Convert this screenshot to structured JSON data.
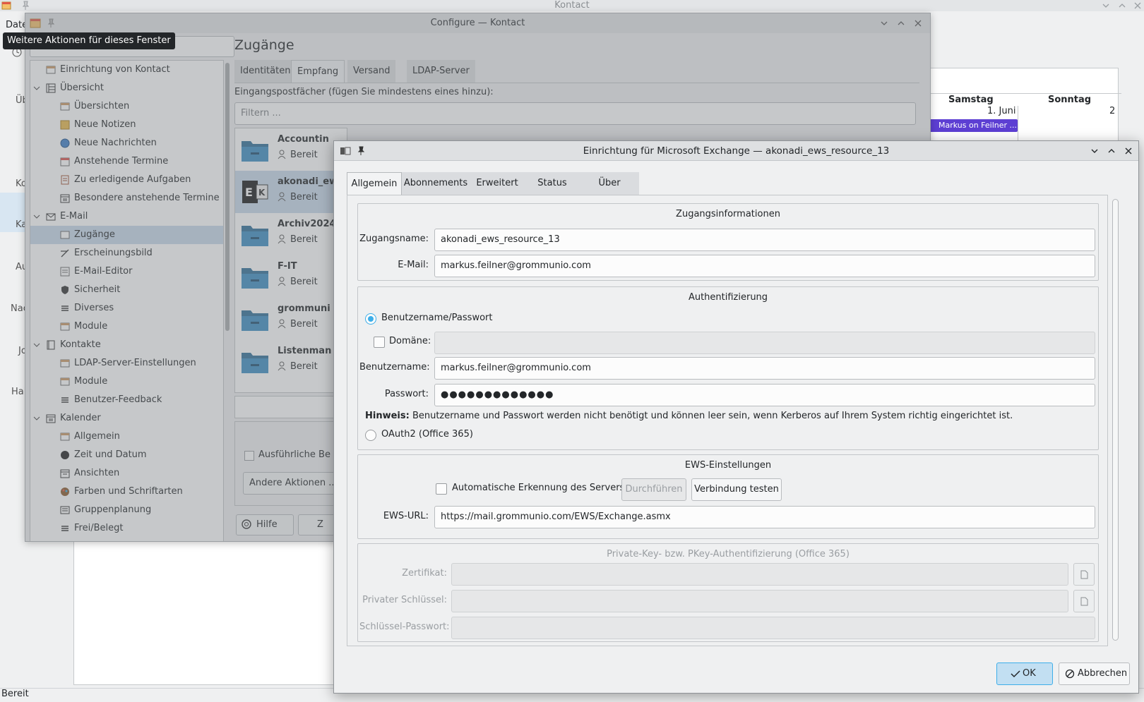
{
  "kontact": {
    "title": "Kontact",
    "menu_file": "Date",
    "sidebar": [
      "Üb",
      "Ka",
      "Ko",
      "Au",
      "Nac",
      "Jo",
      "Hal"
    ],
    "status": "Bereit",
    "calendar": {
      "col_saturday": "Samstag",
      "col_sunday": "Sonntag",
      "date_saturday": "1. Juni",
      "date_sunday": "2",
      "event": "Markus on Feilner ..."
    }
  },
  "tooltip": "Weitere Aktionen für dieses Fenster",
  "configure": {
    "title": "Configure — Kontact",
    "page_title": "Zugänge",
    "tree": [
      {
        "label": "Einrichtung von Kontact",
        "level": 0,
        "icon": "window-icon"
      },
      {
        "label": "Übersicht",
        "level": 0,
        "expanded": true,
        "icon": "overview-icon"
      },
      {
        "label": "Übersichten",
        "level": 1,
        "icon": "window-icon"
      },
      {
        "label": "Neue Notizen",
        "level": 1,
        "icon": "note-icon"
      },
      {
        "label": "Neue Nachrichten",
        "level": 1,
        "icon": "globe-icon"
      },
      {
        "label": "Anstehende Termine",
        "level": 1,
        "icon": "calendar-icon"
      },
      {
        "label": "Zu erledigende Aufgaben",
        "level": 1,
        "icon": "tasks-icon"
      },
      {
        "label": "Besondere anstehende Termine",
        "level": 1,
        "icon": "calendar-icon"
      },
      {
        "label": "E-Mail",
        "level": 0,
        "expanded": true,
        "icon": "mail-icon"
      },
      {
        "label": "Zugänge",
        "level": 1,
        "selected": true,
        "icon": "accounts-icon"
      },
      {
        "label": "Erscheinungsbild",
        "level": 1,
        "icon": "brush-icon"
      },
      {
        "label": "E-Mail-Editor",
        "level": 1,
        "icon": "editor-icon"
      },
      {
        "label": "Sicherheit",
        "level": 1,
        "icon": "shield-icon"
      },
      {
        "label": "Diverses",
        "level": 1,
        "icon": "menu-icon"
      },
      {
        "label": "Module",
        "level": 1,
        "icon": "plugin-icon"
      },
      {
        "label": "Kontakte",
        "level": 0,
        "expanded": true,
        "icon": "contacts-icon"
      },
      {
        "label": "LDAP-Server-Einstellungen",
        "level": 1,
        "icon": "server-icon"
      },
      {
        "label": "Module",
        "level": 1,
        "icon": "plugin-icon"
      },
      {
        "label": "Benutzer-Feedback",
        "level": 1,
        "icon": "menu-icon"
      },
      {
        "label": "Kalender",
        "level": 0,
        "expanded": true,
        "icon": "calendar-icon"
      },
      {
        "label": "Allgemein",
        "level": 1,
        "icon": "window-icon"
      },
      {
        "label": "Zeit und Datum",
        "level": 1,
        "icon": "clock-icon"
      },
      {
        "label": "Ansichten",
        "level": 1,
        "icon": "calendar-icon"
      },
      {
        "label": "Farben und Schriftarten",
        "level": 1,
        "icon": "palette-icon"
      },
      {
        "label": "Gruppenplanung",
        "level": 1,
        "icon": "menu-icon"
      },
      {
        "label": "Frei/Belegt",
        "level": 1,
        "icon": "menu-icon"
      }
    ],
    "tabs": [
      "Identitäten",
      "Empfang",
      "Versand",
      "LDAP-Server"
    ],
    "active_tab": "Empfang",
    "intro": "Eingangspostfächer (fügen Sie mindestens eines hinzu):",
    "filter_placeholder": "Filtern ...",
    "accounts": [
      {
        "name": "Accountin",
        "state": "Bereit"
      },
      {
        "name": "akonadi_ew",
        "state": "Bereit",
        "selected": true,
        "exchange": true
      },
      {
        "name": "Archiv2024",
        "state": "Bereit"
      },
      {
        "name": "F-IT",
        "state": "Bereit"
      },
      {
        "name": "grommuni",
        "state": "Bereit"
      },
      {
        "name": "Listenman",
        "state": "Bereit"
      }
    ],
    "verbose_label": "Ausführliche Be",
    "other_actions": "Andere Aktionen ...",
    "help": "Hilfe",
    "reset_partial": "Z"
  },
  "dialog": {
    "title": "Einrichtung für Microsoft Exchange — akonadi_ews_resource_13",
    "tabs": [
      "Allgemein",
      "Abonnements",
      "Erweitert",
      "Status",
      "Über"
    ],
    "active_tab": "Allgemein",
    "access": {
      "title": "Zugangsinformationen",
      "name_label": "Zugangsname:",
      "name_value": "akonadi_ews_resource_13",
      "email_label": "E-Mail:",
      "email_value": "markus.feilner@grommunio.com"
    },
    "auth": {
      "title": "Authentifizierung",
      "userpass_label": "Benutzername/Passwort",
      "domain_label": "Domäne:",
      "domain_value": "",
      "user_label": "Benutzername:",
      "user_value": "markus.feilner@grommunio.com",
      "password_label": "Passwort:",
      "password_value": "●●●●●●●●●●●●●",
      "hint_bold": "Hinweis:",
      "hint_text": " Benutzername und Passwort werden nicht benötigt und können leer sein, wenn Kerberos auf Ihrem System richtig eingerichtet ist.",
      "oauth_label": "OAuth2 (Office 365)"
    },
    "ews": {
      "title": "EWS-Einstellungen",
      "autodetect_label": "Automatische Erkennung des Servers",
      "run_button": "Durchführen",
      "test_button": "Verbindung testen",
      "url_label": "EWS-URL:",
      "url_value": "https://mail.grommunio.com/EWS/Exchange.asmx"
    },
    "pkey": {
      "title": "Private-Key- bzw. PKey-Authentifizierung (Office 365)",
      "cert_label": "Zertifikat:",
      "key_label": "Privater Schlüssel:",
      "keypass_label": "Schlüssel-Passwort:"
    },
    "ok": "OK",
    "cancel": "Abbrechen"
  },
  "colors": {
    "accent": "#3daee9",
    "selection": "#c9d9ea",
    "event": "#5d3fd3",
    "tooltip_bg": "#232629"
  }
}
